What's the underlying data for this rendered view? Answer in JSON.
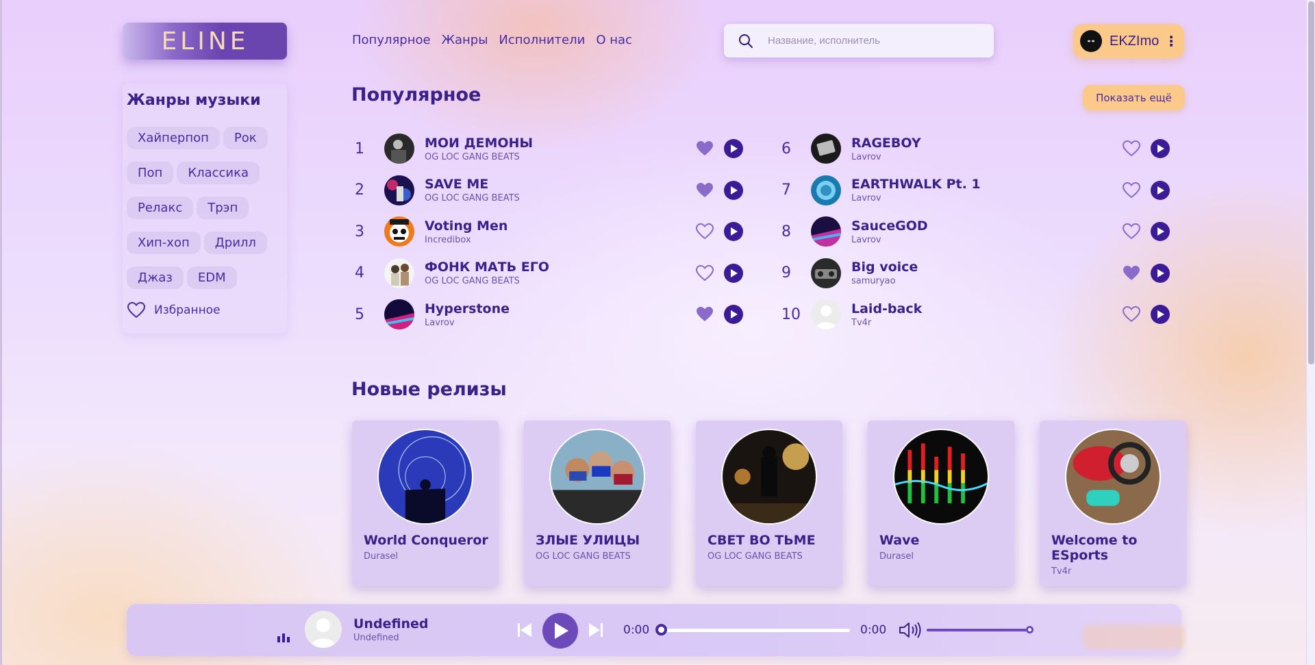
{
  "logo": {
    "text": "ELINE"
  },
  "nav": [
    "Популярное",
    "Жанры",
    "Исполнители",
    "О нас"
  ],
  "search": {
    "placeholder": "Название, исполнитель",
    "value": ""
  },
  "user": {
    "name": "EKZImo",
    "menu_glyph": "⋮"
  },
  "genres": {
    "title": "Жанры музыки",
    "items": [
      "Хайперпоп",
      "Рок",
      "Поп",
      "Классика",
      "Релакс",
      "Трэп",
      "Хип-хоп",
      "Дрилл",
      "Джаз",
      "EDM"
    ],
    "favorites_label": "Избранное"
  },
  "popular": {
    "title": "Популярное",
    "more_label": "Показать ещё",
    "tracks": [
      {
        "n": "1",
        "title": "МОИ ДЕМОНЫ",
        "artist": "OG LOC GANG BEATS",
        "liked": true
      },
      {
        "n": "2",
        "title": "SAVE ME",
        "artist": "OG LOC GANG BEATS",
        "liked": true
      },
      {
        "n": "3",
        "title": "Voting Men",
        "artist": "Incredibox",
        "liked": false
      },
      {
        "n": "4",
        "title": "ФОНК МАТЬ ЕГО",
        "artist": "OG LOC GANG BEATS",
        "liked": false
      },
      {
        "n": "5",
        "title": "Hyperstone",
        "artist": "Lavrov",
        "liked": true
      },
      {
        "n": "6",
        "title": "RAGEBOY",
        "artist": "Lavrov",
        "liked": false
      },
      {
        "n": "7",
        "title": "EARTHWALK Pt. 1",
        "artist": "Lavrov",
        "liked": false
      },
      {
        "n": "8",
        "title": "SauceGOD",
        "artist": "Lavrov",
        "liked": false
      },
      {
        "n": "9",
        "title": "Big voice",
        "artist": "samuryao",
        "liked": true
      },
      {
        "n": "10",
        "title": "Laid-back",
        "artist": "Tv4r",
        "liked": false
      }
    ]
  },
  "releases": {
    "title": "Новые релизы",
    "items": [
      {
        "title": "World Conqueror",
        "artist": "Durasel"
      },
      {
        "title": "ЗЛЫЕ УЛИЦЫ",
        "artist": "OG LOC GANG BEATS"
      },
      {
        "title": "СВЕТ ВО ТЬМЕ",
        "artist": "OG LOC GANG BEATS"
      },
      {
        "title": "Wave",
        "artist": "Durasel"
      },
      {
        "title": "Welcome to ESports",
        "artist": "Tv4r"
      }
    ]
  },
  "player": {
    "title": "Undefined",
    "artist": "Undefined",
    "current_time": "0:00",
    "duration": "0:00",
    "progress": 0,
    "volume": 1
  },
  "colors": {
    "accent": "#3b1c96",
    "accent_light": "#6d4aba",
    "orange": "#fbc98a",
    "heart": "#8a6bc9"
  }
}
